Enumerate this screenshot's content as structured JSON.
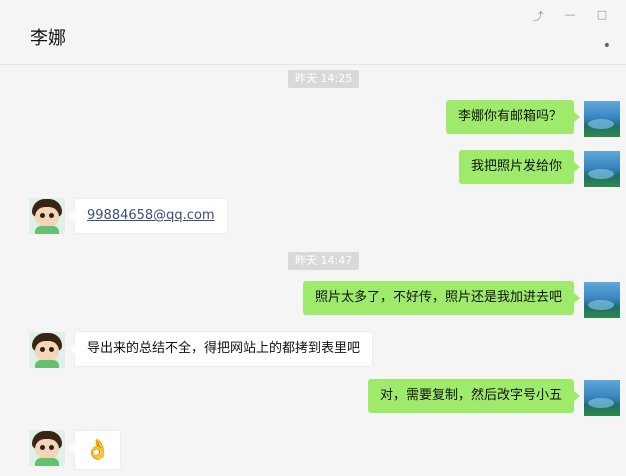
{
  "header": {
    "title": "李娜",
    "pin_icon": "pin-icon",
    "minimize_icon": "minimize-icon",
    "maximize_icon": "maximize-icon",
    "more_icon": "more-icon"
  },
  "chat": {
    "time1": "昨天 14:25",
    "time2": "昨天 14:47",
    "messages": [
      {
        "from": "me",
        "text": "李娜你有邮箱吗？"
      },
      {
        "from": "me",
        "text": "我把照片发给你"
      },
      {
        "from": "her",
        "text": "99884658@qq.com"
      },
      {
        "from": "me",
        "text": "照片太多了，不好传，照片还是我加进去吧"
      },
      {
        "from": "her",
        "text": "导出来的总结不全，得把网站上的都拷到表里吧"
      },
      {
        "from": "me",
        "text": "对，需要复制，然后改字号小五"
      },
      {
        "from": "her",
        "text": "👌"
      }
    ]
  },
  "colors": {
    "me_bubble": "#9eea6a",
    "her_bubble": "#ffffff",
    "timestamp_bg": "#d9d9d9",
    "background": "#f5f5f5"
  }
}
